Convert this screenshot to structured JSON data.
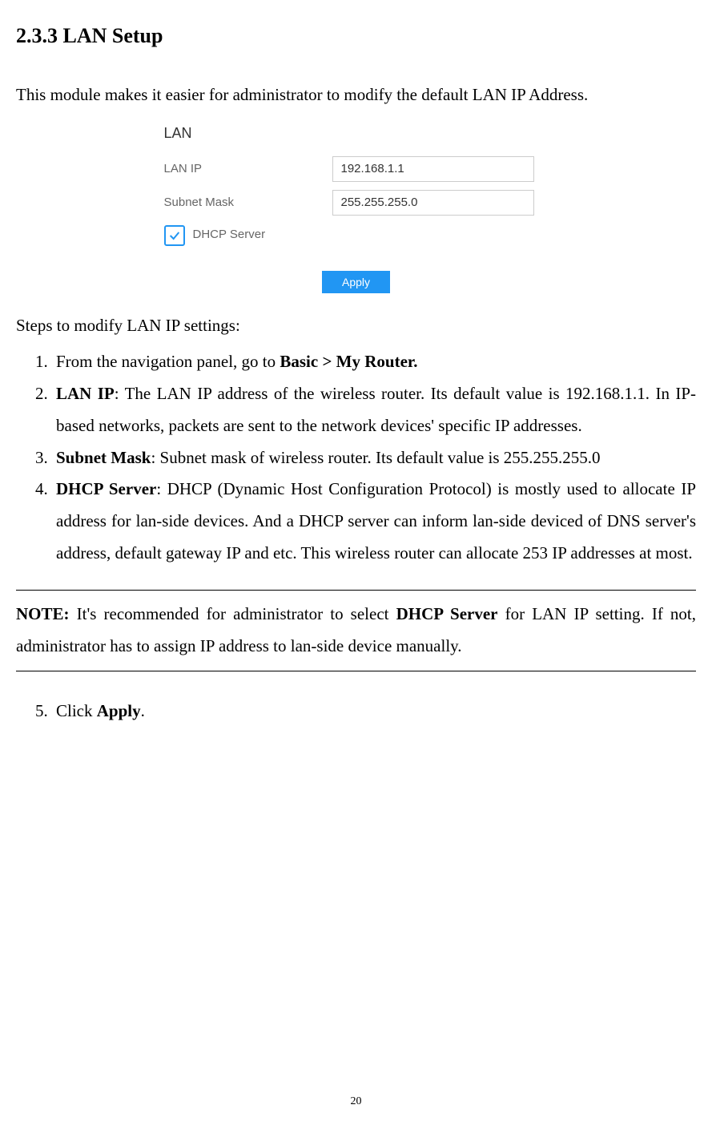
{
  "heading": "2.3.3 LAN Setup",
  "intro": "This module makes it easier for administrator to modify the default LAN IP Address.",
  "screenshot": {
    "panel_title": "LAN",
    "rows": {
      "lan_ip_label": "LAN IP",
      "lan_ip_value": "192.168.1.1",
      "subnet_label": "Subnet Mask",
      "subnet_value": "255.255.255.0",
      "dhcp_label": "DHCP Server",
      "dhcp_checked": true
    },
    "apply_label": "Apply"
  },
  "steps_intro": "Steps to modify LAN IP settings:",
  "steps": {
    "s1_pre": "From the navigation panel, go to ",
    "s1_bold": "Basic > My Router.",
    "s2_bold": "LAN IP",
    "s2_rest": ": The LAN IP address of the wireless router. Its default value is 192.168.1.1. In IP-based networks, packets are sent to the network devices' specific IP addresses.",
    "s3_bold": "Subnet Mask",
    "s3_rest": ": Subnet mask of wireless router. Its default value is 255.255.255.0",
    "s4_bold": "DHCP Server",
    "s4_rest": ": DHCP (Dynamic Host Configuration Protocol) is mostly used to allocate IP address for lan-side devices. And a DHCP server can inform lan-side deviced of DNS server's address, default gateway IP and etc. This wireless router can allocate 253 IP addresses at most.",
    "s5_pre": "Click ",
    "s5_bold": "Apply",
    "s5_post": "."
  },
  "note": {
    "label": "NOTE:",
    "pre": "  It's recommended for administrator to select ",
    "bold": "DHCP Server",
    "post": " for LAN IP setting. If not, administrator has to assign IP address to lan-side device manually."
  },
  "page_number": "20"
}
